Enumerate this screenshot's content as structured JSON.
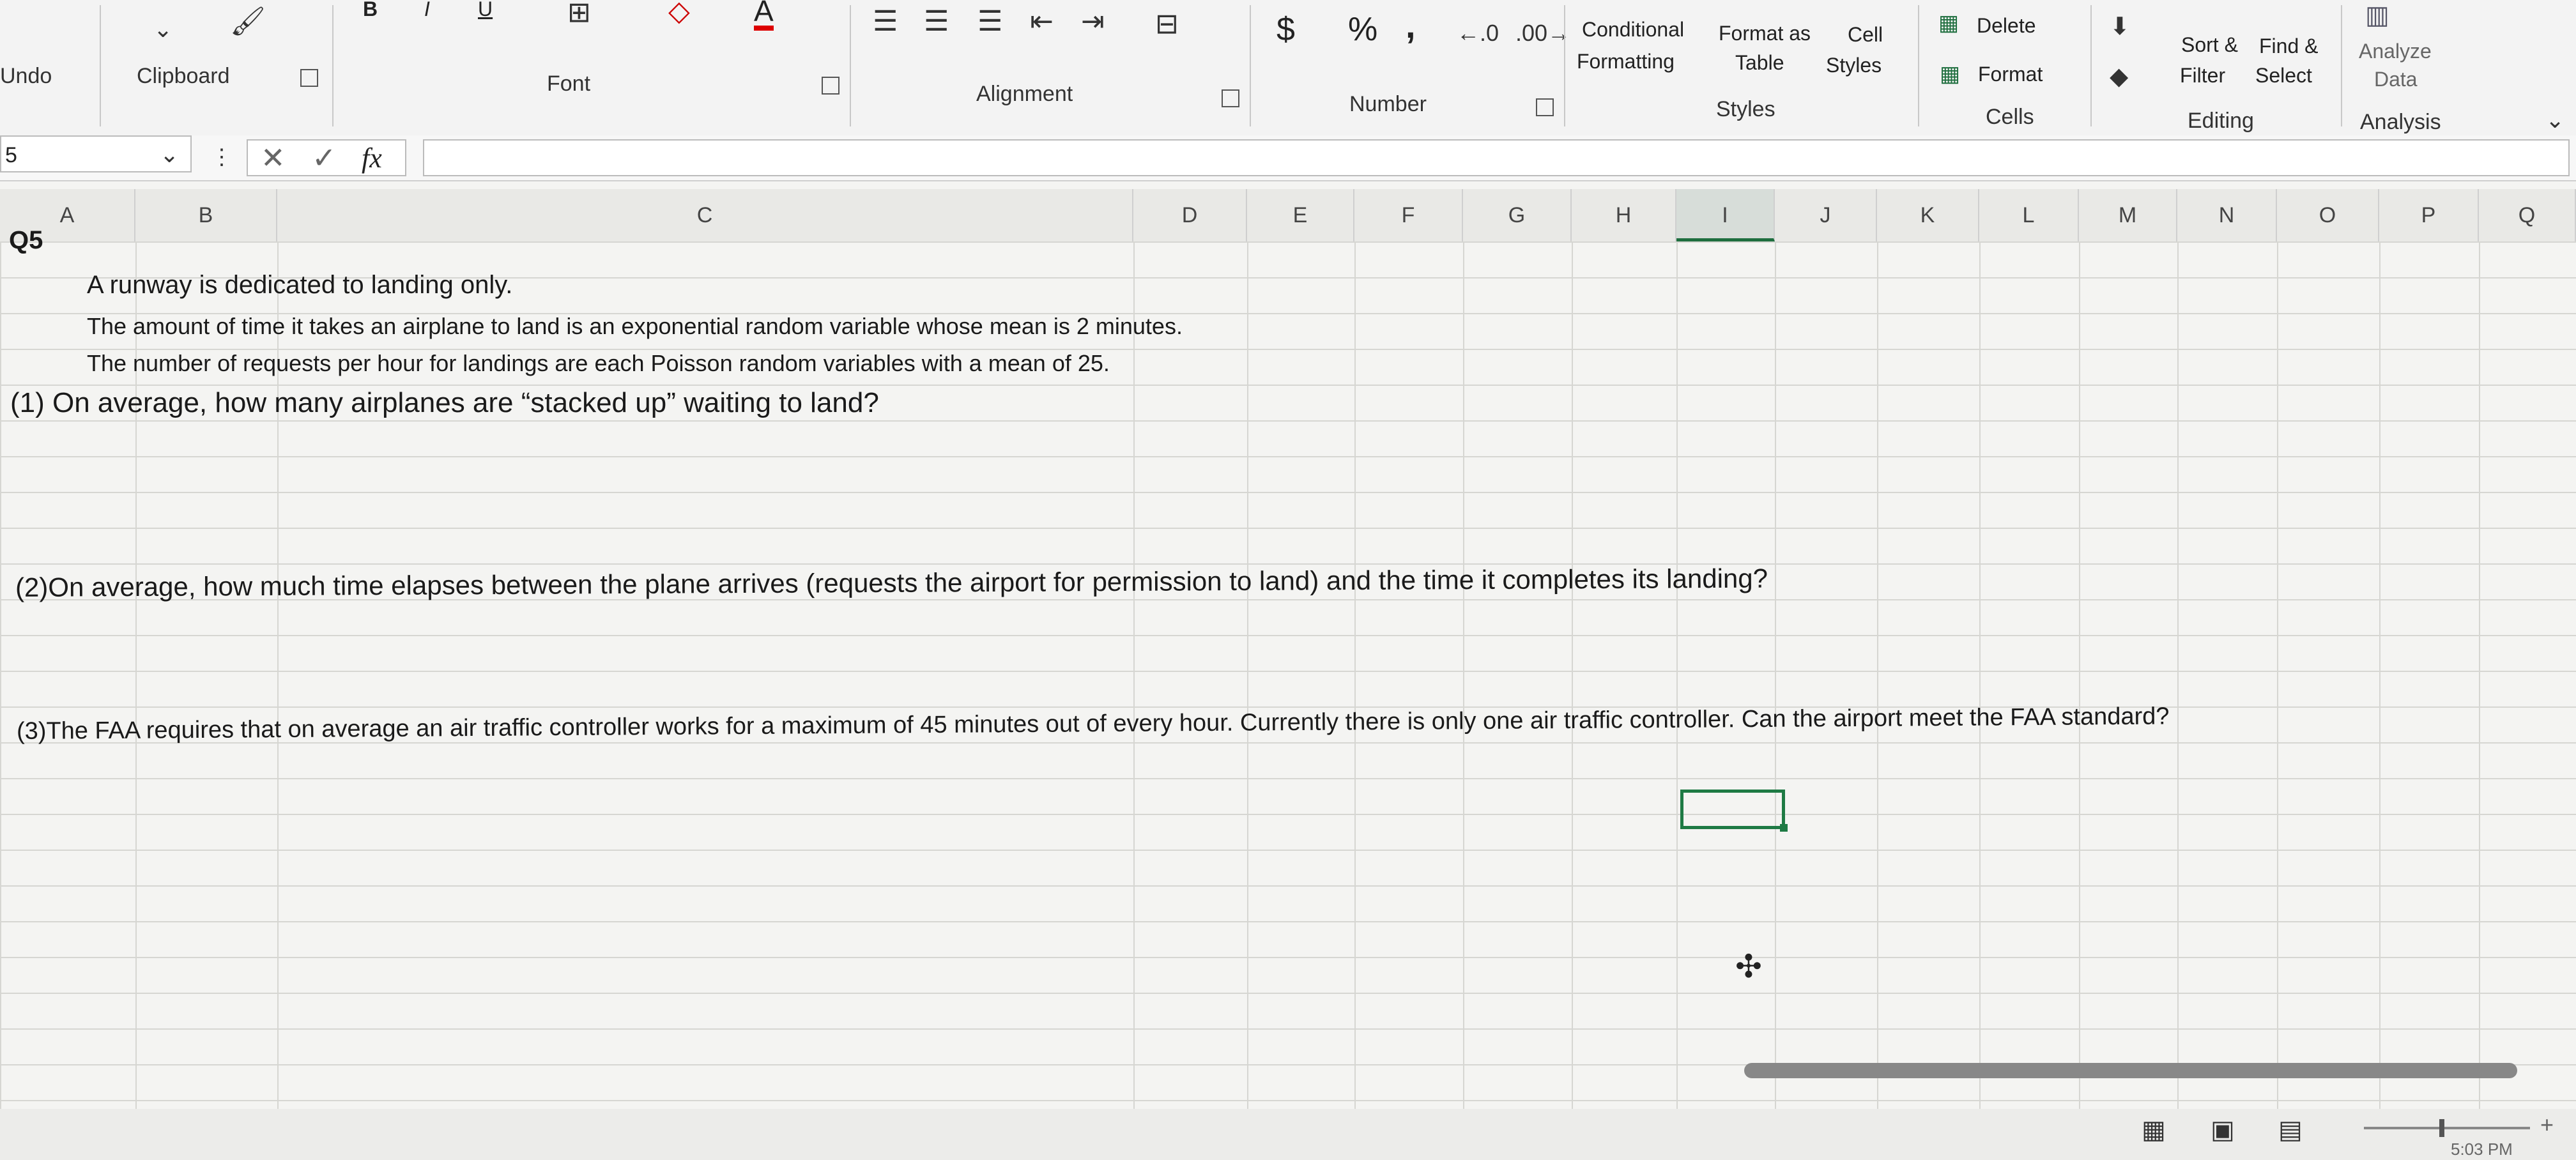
{
  "ribbon": {
    "groups": {
      "undo": "Undo",
      "clipboard": "Clipboard",
      "font": "Font",
      "alignment": "Alignment",
      "number": "Number",
      "styles": "Styles",
      "cells": "Cells",
      "editing": "Editing",
      "analysis": "Analysis"
    },
    "font_buttons": {
      "bold": "B",
      "italic": "I",
      "underline": "U",
      "font_color": "A"
    },
    "number_buttons": {
      "currency": "$",
      "percent": "%",
      "comma": ","
    },
    "styles_buttons": {
      "conditional_line1": "Conditional",
      "conditional_line2": "Formatting",
      "format_table_line1": "Format as",
      "format_table_line2": "Table",
      "cell_styles_line1": "Cell",
      "cell_styles_line2": "Styles"
    },
    "cells_buttons": {
      "delete": "Delete",
      "format": "Format"
    },
    "editing_buttons": {
      "sort_line1": "Sort &",
      "sort_line2": "Filter",
      "find_line1": "Find &",
      "find_line2": "Select"
    },
    "analysis_buttons": {
      "analyze_line1": "Analyze",
      "analyze_line2": "Data"
    }
  },
  "formula_bar": {
    "name_box": "5",
    "fx_label": "fx",
    "value": ""
  },
  "columns": [
    "A",
    "B",
    "C",
    "D",
    "E",
    "F",
    "G",
    "H",
    "I",
    "J",
    "K",
    "L",
    "M",
    "N",
    "O",
    "P",
    "Q"
  ],
  "selected_column": "I",
  "cells": {
    "q5": "Q5",
    "line1": "A runway is dedicated to landing only.",
    "line2": "The amount of time it takes an airplane to land is an exponential random variable whose mean is 2 minutes.",
    "line3": "The number of requests per hour for landings are each Poisson random variables with a mean of 25.",
    "question1": "(1) On average, how many airplanes are “stacked up” waiting to land?",
    "question2": "(2)On average, how much time elapses between the plane arrives (requests the airport for permission to land) and the time it completes its landing?",
    "question3": "(3)The FAA requires that on average an air traffic controller works for a maximum of 45 minutes out of every hour. Currently there is only one air traffic controller. Can the airport meet the FAA standard?"
  },
  "status": {
    "time": "5:03 PM"
  }
}
